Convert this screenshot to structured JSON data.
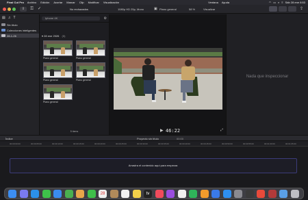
{
  "menubar": {
    "app": "Final Cut Pro",
    "menus": [
      "Archivo",
      "Edición",
      "Acortar",
      "Marcar",
      "Clip",
      "Modificar",
      "Visualización"
    ],
    "center": [
      "Ventana",
      "Ayuda"
    ],
    "clock": "Sáb 28 ene 8:53"
  },
  "toolbar": {
    "download": "⇩",
    "key": "⚿",
    "check": "✓"
  },
  "sidebar": {
    "items": [
      {
        "label": "Sin título",
        "icon": "library-icon"
      },
      {
        "label": "Colecciones inteligentes",
        "icon": "folder-icon"
      },
      {
        "label": "28-1-26",
        "icon": "event-icon"
      }
    ]
  },
  "browser": {
    "filter": "No rechazados",
    "search_placeholder": "Iphone 4K",
    "event_title": "28 ene 2026",
    "event_count": "(5)",
    "clips": [
      {
        "label": "Plano general"
      },
      {
        "label": "Plano general"
      },
      {
        "label": "Plano general"
      },
      {
        "label": "Plano general"
      },
      {
        "label": "Plano general"
      }
    ],
    "status": "5 ítems"
  },
  "viewer": {
    "format": "1080p HD 25p, Mono",
    "clip_name": "Plano general",
    "zoom": "58 %",
    "view_menu": "Visualizar",
    "timecode": "46:22"
  },
  "inspector": {
    "empty": "Nada que inspeccionar"
  },
  "timeline": {
    "index": "Índice",
    "project": "Proyecto sin título",
    "duration": "00:00",
    "ruler": [
      "00:00:00:00",
      "00:00:05:00",
      "00:00:10:00",
      "00:00:15:00",
      "00:00:20:00",
      "00:00:25:00",
      "00:00:30:00",
      "00:00:35:00",
      "00:00:40:00",
      "00:00:45:00",
      "00:00:50:00",
      "00:00:55:00",
      "00:01:00:00",
      "00:01:05:00"
    ],
    "drop_text": "Arrastra el contenido aquí para empezar."
  },
  "dock": {
    "apps": [
      {
        "name": "finder-icon",
        "color": "#3c8ef2"
      },
      {
        "name": "launchpad-icon",
        "color": "#7a7af0"
      },
      {
        "name": "safari-icon",
        "color": "#2b90e8"
      },
      {
        "name": "messages-icon",
        "color": "#3ec24a"
      },
      {
        "name": "mail-icon",
        "color": "#3a8cf0"
      },
      {
        "name": "maps-icon",
        "color": "#4ab050"
      },
      {
        "name": "photos-icon",
        "color": "#e8a64a"
      },
      {
        "name": "facetime-icon",
        "color": "#3fbf4a"
      },
      {
        "name": "calendar-icon",
        "color": "#f0f0f0",
        "text": "28"
      },
      {
        "name": "contacts-icon",
        "color": "#b08a5a"
      },
      {
        "name": "reminders-icon",
        "color": "#f2f2f2"
      },
      {
        "name": "notes-icon",
        "color": "#f2d14a"
      },
      {
        "name": "tv-icon",
        "color": "#222222",
        "text": "tv"
      },
      {
        "name": "music-icon",
        "color": "#f04b5c"
      },
      {
        "name": "podcasts-icon",
        "color": "#9a4ee0"
      },
      {
        "name": "news-icon",
        "color": "#f0f0f0"
      },
      {
        "name": "numbers-icon",
        "color": "#2fb35a"
      },
      {
        "name": "pages-icon",
        "color": "#f29b2c"
      },
      {
        "name": "keynote-icon",
        "color": "#3a7ae8"
      },
      {
        "name": "appstore-icon",
        "color": "#2e8ff0"
      },
      {
        "name": "settings-icon",
        "color": "#8a8a90"
      },
      {
        "name": "finalcut-icon",
        "color": "#3a3a3a"
      },
      {
        "name": "chrome-icon",
        "color": "#e84a3a"
      },
      {
        "name": "compressor-icon",
        "color": "#b23a3a"
      },
      {
        "name": "downloads-icon",
        "color": "#5aa0e8"
      },
      {
        "name": "trash-icon",
        "color": "#bfbfc4"
      }
    ]
  }
}
